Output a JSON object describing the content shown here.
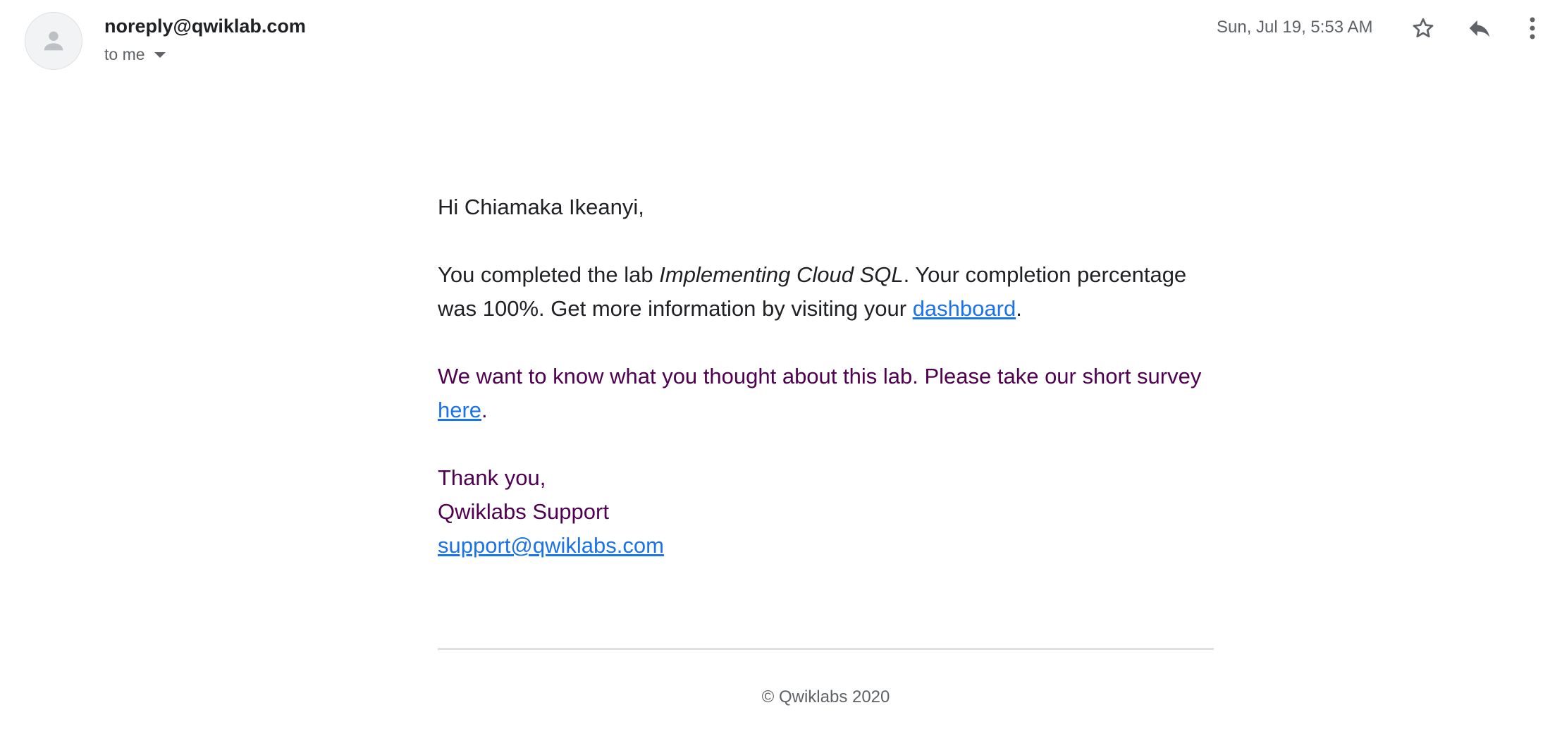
{
  "header": {
    "sender": "noreply@qwiklab.com",
    "recipient": "to me",
    "date": "Sun, Jul 19, 5:53 AM",
    "icons": [
      "avatar-icon",
      "chevron-down-icon",
      "star-icon",
      "reply-icon",
      "more-vert-icon"
    ]
  },
  "message": {
    "greeting": "Hi Chiamaka Ikeanyi,",
    "p1_before": "You completed the lab ",
    "lab_name": "Implementing Cloud SQL",
    "p1_middle": ". Your completion percentage was 100%. Get more information by visiting your ",
    "dashboard_link": "dashboard",
    "p1_end": ".",
    "p2_before": "We want to know what you thought about this lab. Please take our short survey ",
    "survey_link": "here",
    "p2_end": ".",
    "signoff": "Thank you,",
    "signature": "Qwiklabs Support",
    "support_email": "support@qwiklabs.com"
  },
  "footer": {
    "copyright": "© Qwiklabs 2020"
  },
  "colors": {
    "text": "#202124",
    "secondary": "#5f6368",
    "link": "#1a73e8",
    "purple": "#500050"
  }
}
